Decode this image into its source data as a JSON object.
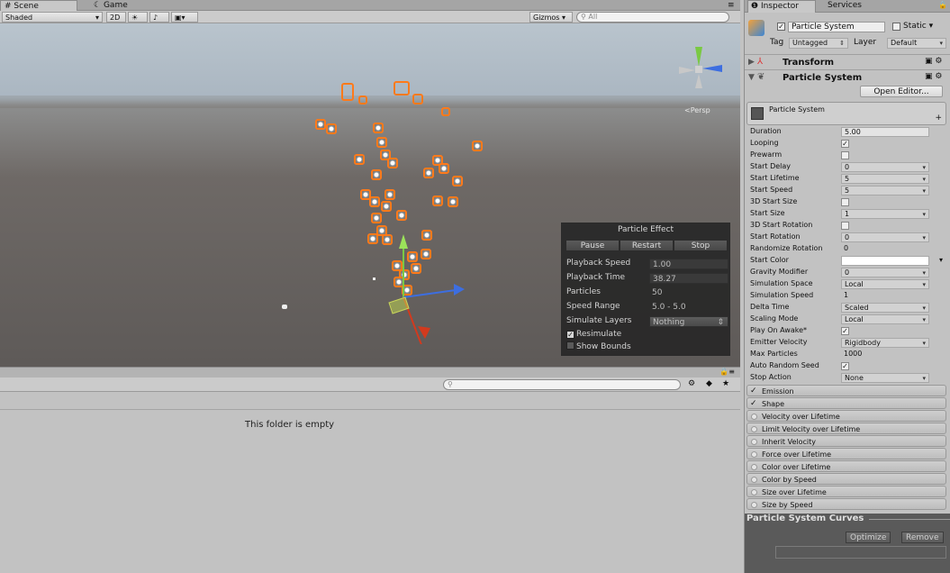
{
  "scene_tabs": {
    "scene": "Scene",
    "game": "Game"
  },
  "scene_toolbar": {
    "shading": "Shaded",
    "mode_2d": "2D",
    "gizmos": "Gizmos",
    "search_placeholder": "All"
  },
  "scene_view": {
    "persp_label": "<Persp"
  },
  "particle_effect": {
    "title": "Particle Effect",
    "buttons": [
      "Pause",
      "Restart",
      "Stop"
    ],
    "rows": [
      {
        "label": "Playback Speed",
        "value": "1.00"
      },
      {
        "label": "Playback Time",
        "value": "38.27"
      },
      {
        "label": "Particles",
        "value": "50"
      },
      {
        "label": "Speed Range",
        "value": "5.0 - 5.0"
      },
      {
        "label": "Simulate Layers",
        "value": "Nothing"
      }
    ],
    "resimulate": "Resimulate",
    "show_bounds": "Show Bounds"
  },
  "project": {
    "empty_message": "This folder is empty"
  },
  "inspector": {
    "tabs": {
      "inspector": "Inspector",
      "services": "Services"
    },
    "object_name": "Particle System",
    "static_label": "Static",
    "tag_label": "Tag",
    "tag_value": "Untagged",
    "layer_label": "Layer",
    "layer_value": "Default",
    "transform_label": "Transform",
    "particle_system_label": "Particle System",
    "open_editor": "Open Editor...",
    "module_header": "Particle System",
    "props": [
      {
        "label": "Duration",
        "value": "5.00",
        "kind": "field"
      },
      {
        "label": "Looping",
        "value": "✓",
        "kind": "check"
      },
      {
        "label": "Prewarm",
        "value": "",
        "kind": "check"
      },
      {
        "label": "Start Delay",
        "value": "0",
        "kind": "dd"
      },
      {
        "label": "Start Lifetime",
        "value": "5",
        "kind": "dd"
      },
      {
        "label": "Start Speed",
        "value": "5",
        "kind": "dd"
      },
      {
        "label": "3D Start Size",
        "value": "",
        "kind": "check"
      },
      {
        "label": "Start Size",
        "value": "1",
        "kind": "dd"
      },
      {
        "label": "3D Start Rotation",
        "value": "",
        "kind": "check"
      },
      {
        "label": "Start Rotation",
        "value": "0",
        "kind": "dd"
      },
      {
        "label": "Randomize Rotation",
        "value": "0",
        "kind": "plain"
      },
      {
        "label": "Start Color",
        "value": "",
        "kind": "color"
      },
      {
        "label": "Gravity Modifier",
        "value": "0",
        "kind": "dd"
      },
      {
        "label": "Simulation Space",
        "value": "Local",
        "kind": "dd"
      },
      {
        "label": "Simulation Speed",
        "value": "1",
        "kind": "plain"
      },
      {
        "label": "Delta Time",
        "value": "Scaled",
        "kind": "dd"
      },
      {
        "label": "Scaling Mode",
        "value": "Local",
        "kind": "dd"
      },
      {
        "label": "Play On Awake*",
        "value": "✓",
        "kind": "check"
      },
      {
        "label": "Emitter Velocity",
        "value": "Rigidbody",
        "kind": "dd"
      },
      {
        "label": "Max Particles",
        "value": "1000",
        "kind": "plain"
      },
      {
        "label": "Auto Random Seed",
        "value": "✓",
        "kind": "check"
      },
      {
        "label": "Stop Action",
        "value": "None",
        "kind": "dd"
      }
    ],
    "modules": [
      {
        "label": "Emission",
        "enabled": true
      },
      {
        "label": "Shape",
        "enabled": true
      },
      {
        "label": "Velocity over Lifetime",
        "enabled": false
      },
      {
        "label": "Limit Velocity over Lifetime",
        "enabled": false
      },
      {
        "label": "Inherit Velocity",
        "enabled": false
      },
      {
        "label": "Force over Lifetime",
        "enabled": false
      },
      {
        "label": "Color over Lifetime",
        "enabled": false
      },
      {
        "label": "Color by Speed",
        "enabled": false
      },
      {
        "label": "Size over Lifetime",
        "enabled": false
      },
      {
        "label": "Size by Speed",
        "enabled": false
      }
    ],
    "curves_title": "Particle System Curves",
    "optimize": "Optimize",
    "remove": "Remove"
  },
  "colors": {
    "particle_outline": "#ff7a1a",
    "panel_bg": "#2c2c2c"
  }
}
